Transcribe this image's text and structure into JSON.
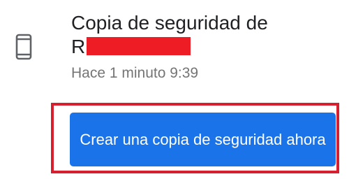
{
  "backup_item": {
    "icon": "smartphone-icon",
    "title_line1": "Copia de seguridad de",
    "title_line2_visible": "R",
    "timestamp": "Hace 1 minuto 9:39"
  },
  "actions": {
    "backup_now_label": "Crear una copia de seguridad ahora"
  },
  "colors": {
    "button": "#1a73e8",
    "highlight": "#d6202f",
    "redaction": "#ee1c25"
  }
}
